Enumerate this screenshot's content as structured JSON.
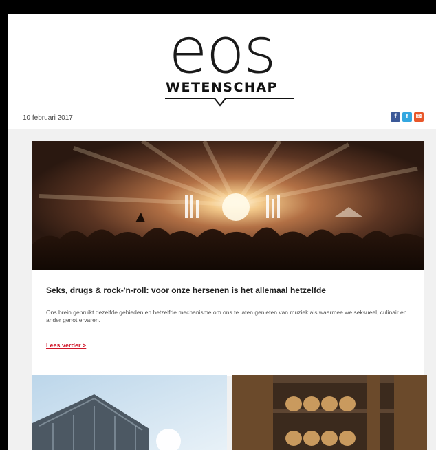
{
  "logo": {
    "word": "eos",
    "sub": "WETENSCHAP"
  },
  "header": {
    "date": "10 februari 2017"
  },
  "social": {
    "items": [
      {
        "icon": "facebook-icon",
        "glyph": "f",
        "color": "#3b5998"
      },
      {
        "icon": "twitter-icon",
        "glyph": "t",
        "color": "#33a7e0"
      },
      {
        "icon": "mail-icon",
        "glyph": "✉",
        "color": "#e8572a"
      }
    ]
  },
  "article": {
    "title": "Seks, drugs & rock-'n-roll: voor onze hersenen is het allemaal hetzelfde",
    "description": "Ons brein gebruikt dezelfde gebieden en hetzelfde mechanisme om ons te laten genieten van muziek als waarmee we seksueel, culinair en ander genot ervaren.",
    "read_more": "Lees verder >"
  },
  "colors": {
    "accent": "#d0182a",
    "background": "#f1f1f1"
  }
}
